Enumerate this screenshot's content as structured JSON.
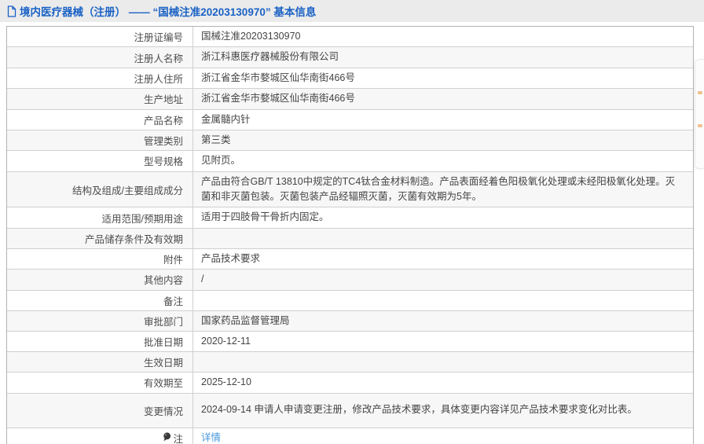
{
  "page": {
    "header": {
      "icon": "document-icon",
      "title": "境内医疗器械（注册） —— “国械注准20203130970” 基本信息"
    },
    "colors": {
      "title_blue": "#1a62c5",
      "link_blue": "#4697dd",
      "band_grey": "#ebebeb",
      "alt_row_grey": "#f7f7f7",
      "border_grey": "#d0d0d0"
    },
    "table": {
      "rows": [
        {
          "label": "注册证编号",
          "value": "国械注准20203130970"
        },
        {
          "label": "注册人名称",
          "value": "浙江科惠医疗器械股份有限公司"
        },
        {
          "label": "注册人住所",
          "value": "浙江省金华市婺城区仙华南街466号"
        },
        {
          "label": "生产地址",
          "value": "浙江省金华市婺城区仙华南街466号"
        },
        {
          "label": "产品名称",
          "value": "金属髓内针"
        },
        {
          "label": "管理类别",
          "value": "第三类"
        },
        {
          "label": "型号规格",
          "value": "见附页。"
        },
        {
          "label": "结构及组成/主要组成成分",
          "value": "产品由符合GB/T 13810中规定的TC4钛合金材料制造。产品表面经着色阳极氧化处理或未经阳极氧化处理。灭菌和非灭菌包装。灭菌包装产品经辐照灭菌，灭菌有效期为5年。",
          "tall": true
        },
        {
          "label": "适用范围/预期用途",
          "value": "适用于四肢骨干骨折内固定。"
        },
        {
          "label": "产品储存条件及有效期",
          "value": ""
        },
        {
          "label": "附件",
          "value": "产品技术要求"
        },
        {
          "label": "其他内容",
          "value": "/"
        },
        {
          "label": "备注",
          "value": ""
        },
        {
          "label": "审批部门",
          "value": "国家药品监督管理局"
        },
        {
          "label": "批准日期",
          "value": "2020-12-11"
        },
        {
          "label": "生效日期",
          "value": ""
        },
        {
          "label": "有效期至",
          "value": "2025-12-10"
        },
        {
          "label": "变更情况",
          "value": "2024-09-14 申请人申请变更注册，修改产品技术要求，具体变更内容详见产品技术要求变化对比表。",
          "tall": true
        },
        {
          "label": "注",
          "value": "详情",
          "icon": "note-balloon-icon",
          "link": true
        }
      ]
    }
  }
}
